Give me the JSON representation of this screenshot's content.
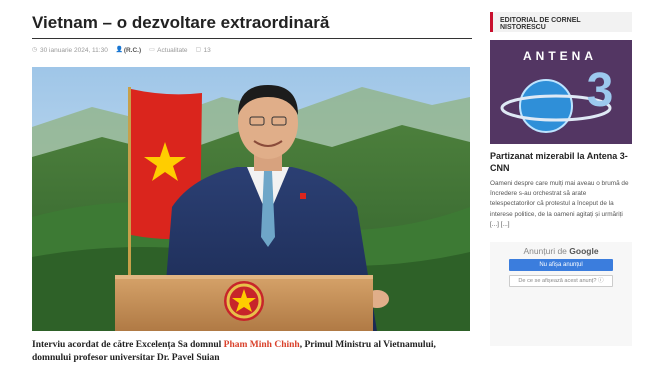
{
  "article": {
    "title": "Vietnam – o dezvoltare extraordinară",
    "date": "30 ianuarie 2024, 11:30",
    "author": "(R.C.)",
    "category": "Actualitate",
    "comments": "13",
    "caption_pre": "Interviu acordat de către Excelența Sa domnul ",
    "caption_name": "Pham Minh Chinh",
    "caption_post": ", Primul Ministru al Vietnamului, domnului profesor universitar Dr. Pavel Suian"
  },
  "sidebar": {
    "heading": "EDITORIAL DE CORNEL NISTORESCU",
    "logo_text": "ANTENA",
    "logo_number": "3",
    "post_title": "Partizanat mizerabil la Antena 3-CNN",
    "post_excerpt": "Oameni despre care mulți mai aveau o brumă de încredere s-au orchestrat să arate telespectatorilor că protestul a început de la interese politice, de la oameni agitați și urmăriți",
    "post_more": "[...] [...]"
  },
  "ads": {
    "label_pre": "Anunțuri de ",
    "label_brand": "Google",
    "hide_button": "Nu afișa anunțul",
    "why_button": "De ce se afișează acest anunț? ⓘ"
  },
  "colors": {
    "accent": "#c8102e",
    "caption_highlight": "#d9412b",
    "flag_red": "#da251d",
    "flag_star": "#ffcd00"
  }
}
